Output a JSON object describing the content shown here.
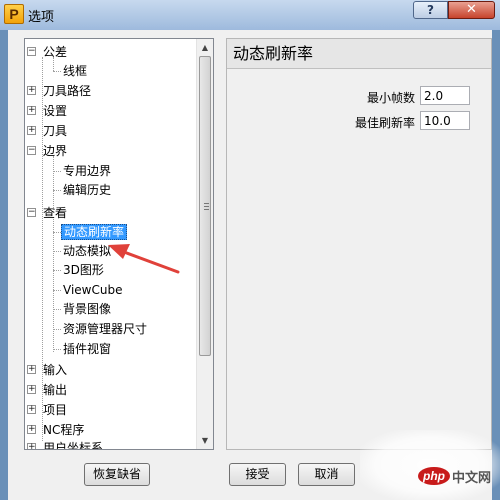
{
  "window": {
    "title": "选项",
    "app_icon_letter": "P",
    "help_label": "?",
    "close_label": "✕"
  },
  "tree": {
    "items": [
      {
        "label": "公差",
        "expander": "−"
      },
      {
        "label": "线框"
      },
      {
        "label": "刀具路径",
        "expander": "+"
      },
      {
        "label": "设置",
        "expander": "+"
      },
      {
        "label": "刀具",
        "expander": "+"
      },
      {
        "label": "边界",
        "expander": "−"
      },
      {
        "label": "专用边界"
      },
      {
        "label": "编辑历史"
      },
      {
        "label": "查看",
        "expander": "−"
      },
      {
        "label": "动态刷新率"
      },
      {
        "label": "动态模拟"
      },
      {
        "label": "3D图形"
      },
      {
        "label": "ViewCube"
      },
      {
        "label": "背景图像"
      },
      {
        "label": "资源管理器尺寸"
      },
      {
        "label": "插件视窗"
      },
      {
        "label": "输入",
        "expander": "+"
      },
      {
        "label": "输出",
        "expander": "+"
      },
      {
        "label": "项目",
        "expander": "+"
      },
      {
        "label": "NC程序",
        "expander": "+"
      },
      {
        "label": "用户坐标系",
        "expander": "+"
      }
    ],
    "selected_label": "动态刷新率"
  },
  "panel": {
    "header": "动态刷新率",
    "fields": [
      {
        "label": "最小帧数",
        "value": "2.0"
      },
      {
        "label": "最佳刷新率",
        "value": "10.0"
      }
    ]
  },
  "buttons": {
    "restore_defaults": "恢复缺省",
    "accept": "接受",
    "cancel": "取消"
  },
  "watermark": {
    "logo_text": "php",
    "site_text": "中文网"
  },
  "colors": {
    "selection": "#3399ff",
    "annotation_arrow": "#e0413a"
  }
}
